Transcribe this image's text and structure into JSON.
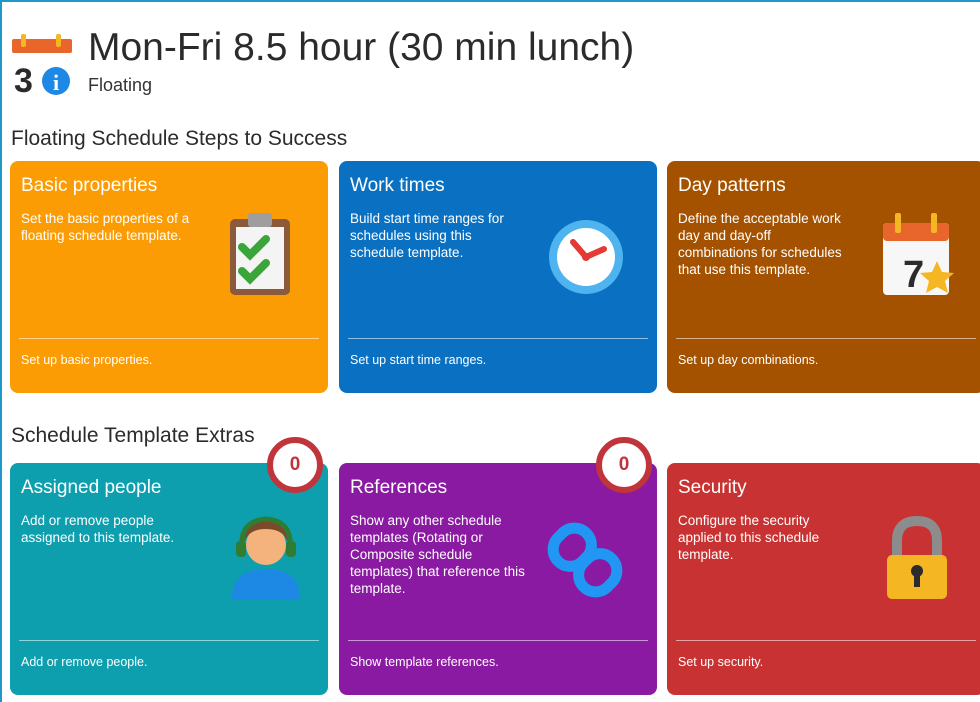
{
  "header": {
    "title": "Mon-Fri 8.5 hour (30 min lunch)",
    "subtitle": "Floating",
    "icon": "calendar-info-icon",
    "icon_digit": "3",
    "icon_info_glyph": "i"
  },
  "sections": {
    "steps_title": "Floating Schedule Steps to Success",
    "extras_title": "Schedule Template Extras"
  },
  "cards": {
    "basic": {
      "title": "Basic properties",
      "description": "Set the basic properties of a floating schedule template.",
      "action": "Set up basic properties.",
      "icon": "clipboard-checklist-icon",
      "color": "#fb9c05"
    },
    "work_times": {
      "title": "Work times",
      "description": "Build start time ranges for schedules using this schedule template.",
      "action": "Set up start time ranges.",
      "icon": "clock-icon",
      "color": "#0a71c2"
    },
    "day_patterns": {
      "title": "Day patterns",
      "description": "Define the acceptable work day and day-off combinations for schedules that use this template.",
      "action": "Set up day combinations.",
      "icon": "calendar-star-icon",
      "icon_digit": "7",
      "color": "#a55200"
    },
    "assigned": {
      "title": "Assigned people",
      "description": "Add or remove people assigned to this template.",
      "action": "Add or remove people.",
      "icon": "person-headset-icon",
      "badge": "0",
      "color": "#0d9fae"
    },
    "references": {
      "title": "References",
      "description": "Show any other schedule templates (Rotating or Composite schedule templates) that reference this template.",
      "action": "Show template references.",
      "icon": "chain-link-icon",
      "badge": "0",
      "color": "#8a1aa1"
    },
    "security": {
      "title": "Security",
      "description": "Configure the security applied to this schedule template.",
      "action": "Set up security.",
      "icon": "padlock-icon",
      "color": "#c83232"
    }
  },
  "colors": {
    "frame_accent": "#1f97c9",
    "badge_ring": "#c0343c"
  }
}
